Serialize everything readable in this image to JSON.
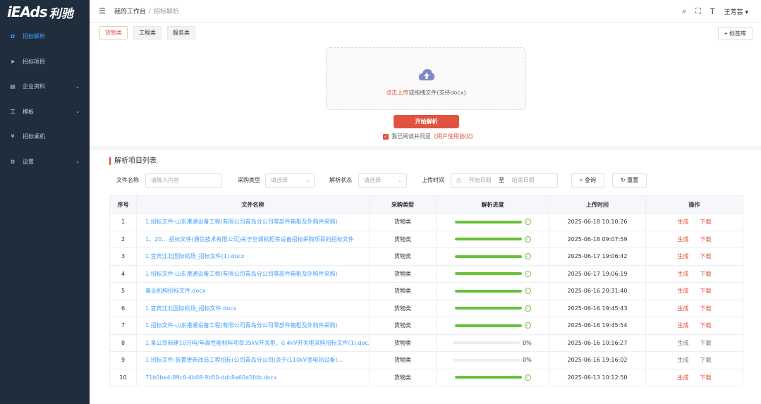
{
  "brand": {
    "logo_text": "iEAds",
    "logo_cn": "利驰"
  },
  "sidebar": {
    "items": [
      {
        "label": "招标解析",
        "icon": "tender-icon",
        "glyph": "✿",
        "active": true,
        "has_chevron": false
      },
      {
        "label": "招标项目",
        "icon": "send-icon",
        "glyph": "➤",
        "active": false,
        "has_chevron": false
      },
      {
        "label": "企业资料",
        "icon": "document-icon",
        "glyph": "▤",
        "active": false,
        "has_chevron": true
      },
      {
        "label": "模板",
        "icon": "template-icon",
        "glyph": "工",
        "active": false,
        "has_chevron": true
      },
      {
        "label": "招标桌机",
        "icon": "yen-icon",
        "glyph": "¥",
        "active": false,
        "has_chevron": false
      },
      {
        "label": "设置",
        "icon": "settings-icon",
        "glyph": "⚙",
        "active": false,
        "has_chevron": true
      }
    ]
  },
  "header": {
    "breadcrumb_home": "我的工作台",
    "breadcrumb_sep": "/",
    "breadcrumb_current": "招标解析",
    "user": "王芳芸"
  },
  "tags": [
    "货物类",
    "工程类",
    "服务类"
  ],
  "lib_button": "标签库",
  "upload": {
    "click_text": "点击上传",
    "rest_text": "或拖拽文件(支持docx)"
  },
  "parse_button": "开始解析",
  "agree": {
    "prefix": "我已阅读并同意",
    "link": "《用户使用协议》"
  },
  "section_title": "解析项目列表",
  "filters": {
    "file_name_label": "文件名称",
    "file_name_placeholder": "请输入内容",
    "category_label": "采购类型",
    "category_placeholder": "请选择",
    "status_label": "解析状态",
    "status_placeholder": "请选择",
    "time_label": "上传时间",
    "time_start": "开始日期",
    "time_sep": "至",
    "time_end": "结束日期",
    "search_label": "查询",
    "reset_label": "重置"
  },
  "table": {
    "headers": [
      "序号",
      "文件名称",
      "采购类型",
      "解析进度",
      "上传时间",
      "操作"
    ],
    "rows": [
      {
        "no": "1",
        "name": "1.招标文件-山东港通设备工程(有限公司青岛分公司零部件箱柜及外购件采购)",
        "type": "货物类",
        "progress": 1.0,
        "time": "2025-06-18 10:10:26",
        "gen": "生成",
        "dl": "下载",
        "done": true
      },
      {
        "no": "2",
        "name": "1、20... 招标文件(通信技术有限公司)关于空调机柜等设备招标采购项目的招标文件",
        "type": "货物类",
        "progress": 1.0,
        "time": "2025-06-18 09:07:59",
        "gen": "生成",
        "dl": "下载",
        "done": true
      },
      {
        "no": "3",
        "name": "1.宜宾江北国际机场_招标文件(1).docx",
        "type": "货物类",
        "progress": 1.0,
        "time": "2025-06-17 19:06:42",
        "gen": "生成",
        "dl": "下载",
        "done": true
      },
      {
        "no": "4",
        "name": "1.招标文件-山东港通设备工程(有限公司青岛分公司零部件箱柜及外购件采购)",
        "type": "货物类",
        "progress": 1.0,
        "time": "2025-06-17 19:06:19",
        "gen": "生成",
        "dl": "下载",
        "done": true
      },
      {
        "no": "5",
        "name": "事业机构招标文件.docx",
        "type": "货物类",
        "progress": 1.0,
        "time": "2025-06-16 20:31:40",
        "gen": "生成",
        "dl": "下载",
        "done": true
      },
      {
        "no": "6",
        "name": "1.宜宾江北国际机场_招标文件.docx",
        "type": "货物类",
        "progress": 1.0,
        "time": "2025-06-16 19:45:43",
        "gen": "生成",
        "dl": "下载",
        "done": true
      },
      {
        "no": "7",
        "name": "1.招标文件-山东港通设备工程(有限公司青岛分公司零部件箱柜及外购件采购)",
        "type": "货物类",
        "progress": 1.0,
        "time": "2025-06-16 19:45:54",
        "gen": "生成",
        "dl": "下载",
        "done": true
      },
      {
        "no": "8",
        "name": "1.某公司新建10万吨/年高性能材料项目35kV开关柜、0.4kV开关柜采购招标文件(1).docx",
        "type": "货物类",
        "progress": 0.0,
        "pct": "0%",
        "time": "2025-06-16 10:16:27",
        "gen": "生成",
        "dl": "下载",
        "done": false
      },
      {
        "no": "9",
        "name": "1.招标文件-装置更新改造工程招标(公司青岛分公司)关于(110kV变电站设备)...",
        "type": "货物类",
        "progress": 0.0,
        "pct": "0%",
        "time": "2025-06-16 19:16:02",
        "gen": "生成",
        "dl": "下载",
        "done": false
      },
      {
        "no": "10",
        "name": "71b0be4-89c6-4b08-9b50-ddc8a60a5fdb.docx",
        "type": "货物类",
        "progress": 1.0,
        "time": "2025-06-13 10:12:50",
        "gen": "生成",
        "dl": "下载",
        "done": true
      }
    ]
  }
}
